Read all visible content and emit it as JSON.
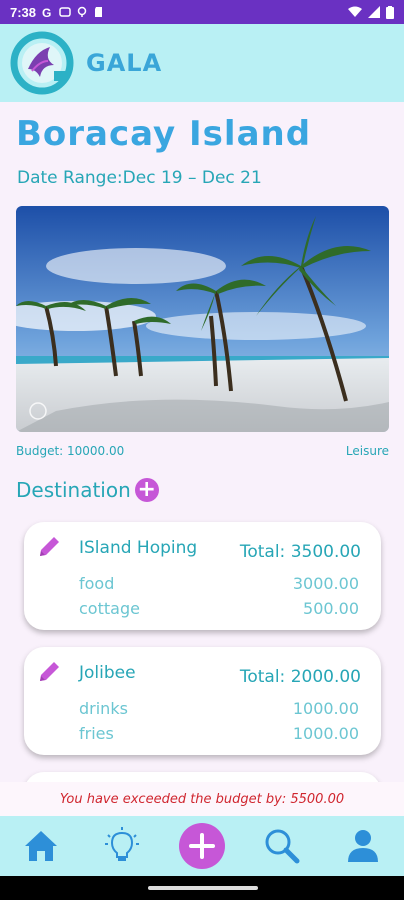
{
  "status": {
    "time": "7:38"
  },
  "app": {
    "brand": "GALA"
  },
  "trip": {
    "title": "Boracay Island",
    "date_range": "Date Range:Dec 19 – Dec 21",
    "budget": "Budget: 10000.00",
    "category": "Leisure"
  },
  "destination": {
    "label": "Destination"
  },
  "cards": [
    {
      "name": "ISland Hoping",
      "total": "Total: 3500.00",
      "items": [
        {
          "label": "food",
          "amount": "3000.00"
        },
        {
          "label": "cottage",
          "amount": "500.00"
        }
      ]
    },
    {
      "name": "Jolibee",
      "total": "Total: 2000.00",
      "items": [
        {
          "label": "drinks",
          "amount": "1000.00"
        },
        {
          "label": "fries",
          "amount": "1000.00"
        }
      ]
    }
  ],
  "alert": {
    "text": "You have exceeded the budget by: 5500.00"
  },
  "nav": [
    "home-icon",
    "lightbulb-icon",
    "add-icon",
    "search-icon",
    "profile-icon"
  ],
  "colors": {
    "appbar": "#b9f0f4",
    "accent": "#c657d7",
    "teal": "#27a6b6",
    "title": "#3aa6e0",
    "alert": "#d0262f"
  }
}
